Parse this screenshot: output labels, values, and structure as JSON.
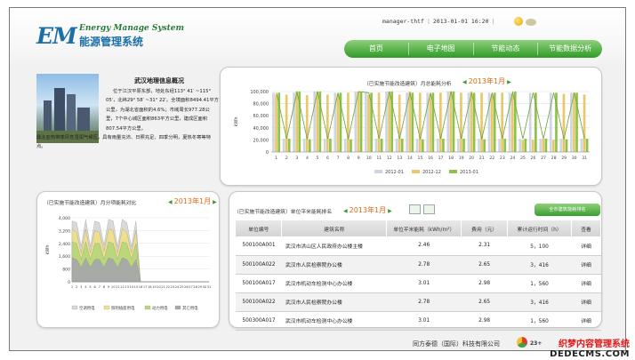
{
  "header": {
    "logo_mark": "EM",
    "logo_subtitle": "Energy Manage System",
    "logo_title": "能源管理系统",
    "user": "manager-thtf",
    "datetime": "2013-01-01 16:20"
  },
  "nav": {
    "items": [
      {
        "label": "首页"
      },
      {
        "label": "电子地图"
      },
      {
        "label": "节能动态"
      },
      {
        "label": "节能数据分析"
      }
    ]
  },
  "info": {
    "title": "武汉地理信息概况",
    "paragraph1": "位于江汉平原东部，地处东经113° 41′ ~115° 05′，北纬29° 58′ ~31° 22′。全境面积8494.41平方公里，为湖北省面积的4.6%；市域周长977.28公里，7个中心城区面积863平方公里，建成区面积807.54平方公里。",
    "paragraph2": "属北亚热带季风性湿润气候区，具有雨量充沛、日照充足、四季分明，夏热冬寒等特点。"
  },
  "monthly_chart": {
    "title": "（已实施节能改造建筑）月总能耗分析",
    "month": "2013年1月",
    "ylabel": "kWh",
    "chart_data": {
      "type": "bar",
      "categories": [
        "1",
        "2",
        "3",
        "4",
        "5",
        "6",
        "7",
        "8",
        "9",
        "10",
        "11",
        "12",
        "13",
        "14",
        "15",
        "16",
        "17",
        "18",
        "19",
        "20",
        "21",
        "22",
        "23",
        "24",
        "25",
        "26",
        "27",
        "28",
        "29",
        "30",
        "31"
      ],
      "ylim": [
        0,
        100000
      ],
      "yticks": [
        0,
        20000,
        40000,
        60000,
        80000,
        100000
      ],
      "ytick_labels": [
        "0",
        "20,000",
        "40,000",
        "60,000",
        "80,000",
        "100,000"
      ],
      "legend_position": "bottom",
      "series": [
        {
          "name": "2012-01",
          "color": "#cfd6e2",
          "values": [
            98000,
            22000,
            98000,
            22000,
            100000,
            22000,
            98000,
            22000,
            100000,
            98000,
            22000,
            100000,
            22000,
            98000,
            22000,
            98000,
            22000,
            100000,
            22000,
            98000,
            22000,
            98000,
            22000,
            98000,
            22000,
            98000,
            22000,
            98000,
            22000,
            98000,
            22000
          ]
        },
        {
          "name": "2012-12",
          "color": "#e8c86a",
          "values": [
            95000,
            95000,
            100000,
            94000,
            100000,
            95000,
            95000,
            98000,
            100000,
            95000,
            98000,
            100000,
            95000,
            100000,
            98000,
            95000,
            98000,
            100000,
            98000,
            100000,
            98000,
            95000,
            98000,
            96000,
            20000,
            20000,
            22000,
            20000,
            96000,
            98000,
            95000
          ]
        },
        {
          "name": "2013-01",
          "color": "#8fc24a",
          "values": [
            98000,
            22000,
            100000,
            21000,
            100000,
            22000,
            98000,
            21000,
            100000,
            98000,
            22000,
            100000,
            22000,
            98000,
            21000,
            98000,
            22000,
            100000,
            22000,
            98000,
            21000,
            98000,
            22000,
            100000,
            22000,
            98000,
            22000,
            98000,
            21000,
            98000,
            22000
          ]
        }
      ]
    }
  },
  "sub_chart": {
    "title": "（已实施节能改造建筑）月分项能耗对比",
    "month": "2013年1月",
    "ylabel": "kWh",
    "chart_data": {
      "type": "area",
      "x": [
        1,
        2,
        3,
        4,
        5,
        6,
        7,
        8,
        9,
        10,
        11,
        12,
        13,
        14,
        15,
        16,
        17,
        18,
        19,
        20,
        21,
        22,
        23,
        24,
        25,
        26,
        27,
        28,
        29,
        30,
        31
      ],
      "ylim": [
        0,
        4000
      ],
      "yticks": [
        0,
        800,
        1600,
        2400,
        3200,
        4000
      ],
      "ytick_labels": [
        "0",
        "800",
        "1,600",
        "2,400",
        "3,200",
        "4,000"
      ],
      "legend_position": "bottom",
      "series": [
        {
          "name": "空调用电",
          "color": "#d8d8d8",
          "values": [
            3800,
            3700,
            2200,
            3900,
            2200,
            3800,
            3700,
            2300,
            3900,
            3800,
            2200,
            3900,
            3700,
            2200,
            3800,
            0,
            0,
            0,
            0,
            0,
            0,
            0,
            0,
            0,
            0,
            0,
            0,
            0,
            0,
            0,
            0
          ]
        },
        {
          "name": "照明插座用电",
          "color": "#f0e08a",
          "values": [
            3300,
            3100,
            1800,
            3300,
            1800,
            3200,
            3100,
            1900,
            3300,
            3200,
            1800,
            3300,
            3100,
            1800,
            3200,
            0,
            0,
            0,
            0,
            0,
            0,
            0,
            0,
            0,
            0,
            0,
            0,
            0,
            0,
            0,
            0
          ]
        },
        {
          "name": "动力用电",
          "color": "#b8d77a",
          "values": [
            2500,
            2400,
            1400,
            2500,
            1400,
            2400,
            2400,
            1400,
            2500,
            2400,
            1400,
            2500,
            2400,
            1400,
            2400,
            0,
            0,
            0,
            0,
            0,
            0,
            0,
            0,
            0,
            0,
            0,
            0,
            0,
            0,
            0,
            0
          ]
        },
        {
          "name": "其它用电",
          "color": "#a8a8a8",
          "values": [
            1500,
            1400,
            900,
            1500,
            900,
            1400,
            1400,
            900,
            1500,
            1400,
            900,
            1500,
            1400,
            900,
            1400,
            0,
            0,
            0,
            0,
            0,
            0,
            0,
            0,
            0,
            0,
            0,
            0,
            0,
            0,
            0,
            0
          ]
        }
      ]
    }
  },
  "ranking": {
    "title": "（已实施节能改造建筑）单位平米能耗排名",
    "month": "2013年1月",
    "button_label": "全市建筑能耗排名",
    "columns": [
      "单位编号",
      "建筑名称",
      "单位平米能耗（kWh/m²）",
      "费用（元）",
      "累计运行时间（h）",
      "查看"
    ],
    "rows": [
      {
        "id": "500100A001",
        "name": "武汉市洪山区人民政府办公楼主楼",
        "energy": "2.46",
        "cost": "2.31",
        "hours": "5，100",
        "action": "详细"
      },
      {
        "id": "500100A022",
        "name": "武汉市人民检察院办公楼",
        "energy": "2.78",
        "cost": "2.65",
        "hours": "3，416",
        "action": "详细"
      },
      {
        "id": "500100A017",
        "name": "武汉市机动车检测中心办公楼",
        "energy": "3.01",
        "cost": "2.98",
        "hours": "1，560",
        "action": "详细"
      },
      {
        "id": "500100A022",
        "name": "武汉市人民检察院办公楼",
        "energy": "2.78",
        "cost": "2.65",
        "hours": "3，416",
        "action": "详细"
      },
      {
        "id": "500300A017",
        "name": "武汉市机动车检测中心办公楼",
        "energy": "3.01",
        "cost": "2.98",
        "hours": "1，560",
        "action": "详细"
      }
    ]
  },
  "footer": {
    "company": "同方泰德（国际）科技有限公司",
    "badge": "23+"
  },
  "watermark": {
    "line1": "织梦内容管理系统",
    "line2": "DEDECMS.COM"
  },
  "colors": {
    "nav_green": "#3a9e30",
    "accent_orange": "#e06a10",
    "logo_blue": "#1d6fa8"
  }
}
